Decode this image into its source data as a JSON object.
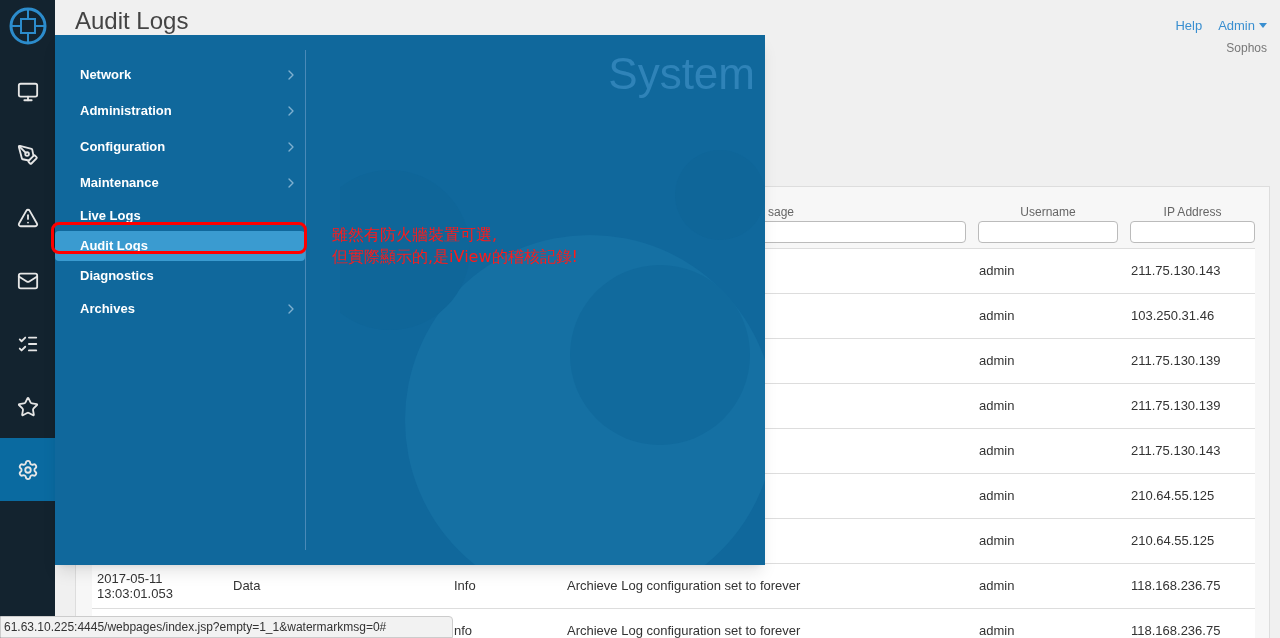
{
  "page_title": "Audit Logs",
  "top_links": {
    "help": "Help",
    "user": "Admin",
    "org": "Sophos"
  },
  "sidebar": [
    {
      "kind": "monitor",
      "selected": false
    },
    {
      "kind": "reports",
      "selected": false
    },
    {
      "kind": "alert",
      "selected": false
    },
    {
      "kind": "mail",
      "selected": false
    },
    {
      "kind": "tasks",
      "selected": false
    },
    {
      "kind": "favorites",
      "selected": false
    },
    {
      "kind": "settings",
      "selected": true
    }
  ],
  "table": {
    "columns": [
      {
        "label": "sage"
      },
      {
        "label": "Username"
      },
      {
        "label": "IP Address"
      }
    ],
    "rows": [
      {
        "username": "admin",
        "ip": "211.75.130.143"
      },
      {
        "username": "admin",
        "ip": "103.250.31.46"
      },
      {
        "username": "admin",
        "ip": "211.75.130.139"
      },
      {
        "username": "admin",
        "ip": "211.75.130.139"
      },
      {
        "username": "admin",
        "ip": "211.75.130.143"
      },
      {
        "username": "admin",
        "ip": "210.64.55.125"
      },
      {
        "username": "admin",
        "ip": "210.64.55.125"
      },
      {
        "date": "2017-05-11",
        "time": "13:03:01.053",
        "category": "Data",
        "severity": "Info",
        "message": "Archieve Log configuration set to forever",
        "username": "admin",
        "ip": "118.168.236.75"
      },
      {
        "severity": "nfo",
        "message": "Archieve Log configuration set to forever",
        "username": "admin",
        "ip": "118.168.236.75"
      }
    ]
  },
  "menu": {
    "title": "System",
    "items": [
      {
        "label": "Network",
        "has_submenu": true,
        "selected": false
      },
      {
        "label": "Administration",
        "has_submenu": true,
        "selected": false
      },
      {
        "label": "Configuration",
        "has_submenu": true,
        "selected": false
      },
      {
        "label": "Maintenance",
        "has_submenu": true,
        "selected": false
      },
      {
        "label": "Live Logs",
        "has_submenu": false,
        "selected": false
      },
      {
        "label": "Audit Logs",
        "has_submenu": false,
        "selected": true
      },
      {
        "label": "Diagnostics",
        "has_submenu": false,
        "selected": false
      },
      {
        "label": "Archives",
        "has_submenu": true,
        "selected": false
      }
    ]
  },
  "annotation": [
    "雖然有防火牆裝置可選,",
    "但實際顯示的,是iView的稽核記錄!"
  ],
  "status_bar": "61.63.10.225:4445/webpages/index.jsp?empty=1_1&watermarkmsg=0#"
}
